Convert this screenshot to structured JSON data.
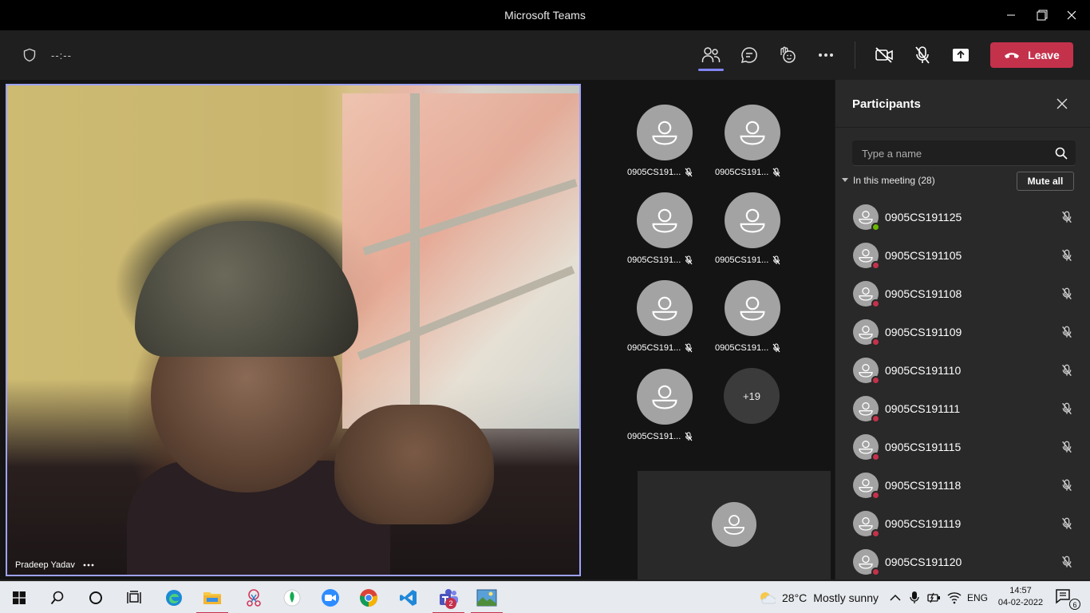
{
  "window": {
    "title": "Microsoft Teams"
  },
  "toolbar": {
    "timer": "--:--",
    "leave_label": "Leave"
  },
  "video": {
    "speaker_name": "Pradeep Yadav"
  },
  "gallery": {
    "tiles": [
      {
        "name": "0905CS191..."
      },
      {
        "name": "0905CS191..."
      },
      {
        "name": "0905CS191..."
      },
      {
        "name": "0905CS191..."
      },
      {
        "name": "0905CS191..."
      },
      {
        "name": "0905CS191..."
      },
      {
        "name": "0905CS191..."
      }
    ],
    "overflow_label": "+19"
  },
  "panel": {
    "title": "Participants",
    "search_placeholder": "Type a name",
    "section_label": "In this meeting (28)",
    "mute_all_label": "Mute all",
    "participants": [
      {
        "name": "0905CS191125",
        "status": "available"
      },
      {
        "name": "0905CS191105",
        "status": "busy"
      },
      {
        "name": "0905CS191108",
        "status": "busy"
      },
      {
        "name": "0905CS191109",
        "status": "busy"
      },
      {
        "name": "0905CS191110",
        "status": "busy"
      },
      {
        "name": "0905CS191111",
        "status": "busy"
      },
      {
        "name": "0905CS191115",
        "status": "busy"
      },
      {
        "name": "0905CS191118",
        "status": "busy"
      },
      {
        "name": "0905CS191119",
        "status": "busy"
      },
      {
        "name": "0905CS191120",
        "status": "busy"
      }
    ]
  },
  "taskbar": {
    "weather_temp": "28°C",
    "weather_text": "Mostly sunny",
    "language": "ENG",
    "time": "14:57",
    "date": "04-02-2022",
    "teams_badge": "2",
    "notification_count": "6"
  },
  "colors": {
    "accent": "#7f85f5",
    "leave": "#c4314b",
    "available": "#6bb700",
    "busy": "#c4314b"
  }
}
